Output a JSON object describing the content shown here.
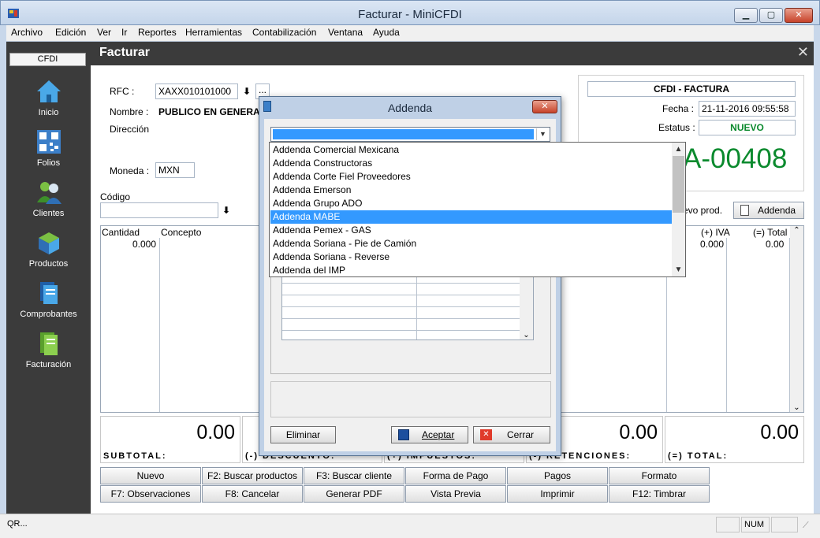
{
  "window": {
    "title": "Facturar - MiniCFDI",
    "minimize": "▁",
    "maximize": "▢",
    "close": "✕"
  },
  "menu": [
    "Archivo",
    "Edición",
    "Ver",
    "Ir",
    "Reportes",
    "Herramientas",
    "Contabilización",
    "Ventana",
    "Ayuda"
  ],
  "sidebar": {
    "tab": "CFDI",
    "items": [
      {
        "label": "Inicio",
        "icon": "house-icon"
      },
      {
        "label": "Folios",
        "icon": "qr-code-icon"
      },
      {
        "label": "Clientes",
        "icon": "users-icon"
      },
      {
        "label": "Productos",
        "icon": "box-icon"
      },
      {
        "label": "Comprobantes",
        "icon": "documents-icon"
      },
      {
        "label": "Facturación",
        "icon": "invoice-icon"
      }
    ]
  },
  "page": {
    "title": "Facturar",
    "close": "✕"
  },
  "form": {
    "rfc_label": "RFC :",
    "rfc_value": "XAXX010101000",
    "nombre_label": "Nombre :",
    "nombre_value": "PUBLICO EN GENERAL",
    "direccion_label": "Dirección",
    "moneda_label": "Moneda :",
    "moneda_value": "MXN",
    "codigo_label": "Código",
    "nuevo_prod": "evo prod.",
    "addenda_button": "Addenda",
    "browse": "..."
  },
  "cfdi": {
    "header": "CFDI - FACTURA",
    "fecha_label": "Fecha :",
    "fecha_value": "21-11-2016 09:55:58",
    "estatus_label": "Estatus :",
    "estatus_value": "NUEVO",
    "folio": "A-00408"
  },
  "grid": {
    "headers": {
      "cantidad": "Cantidad",
      "concepto": "Concepto",
      "iva": "(+) IVA",
      "total": "(=) Total"
    },
    "row": {
      "cantidad": "0.000",
      "iva": "0.000",
      "total": "0.00"
    }
  },
  "totals": {
    "subtotal": {
      "value": "0.00",
      "label": "SUBTOTAL:"
    },
    "descuento": {
      "label": "(-) DESCUENTO:"
    },
    "impuestos": {
      "label": "(+) IMPUESTOS:"
    },
    "retenciones": {
      "value": "0.00",
      "label": "(-) RETENCIONES:"
    },
    "total": {
      "value": "0.00",
      "label": "(=) TOTAL:"
    }
  },
  "function_buttons": {
    "row1": [
      "Nuevo",
      "F2: Buscar productos",
      "F3: Buscar cliente",
      "Forma de Pago",
      "Pagos",
      "Formato"
    ],
    "row2": [
      "F7: Observaciones",
      "F8: Cancelar",
      "Generar PDF",
      "Vista Previa",
      "Imprimir",
      "F12:  Timbrar"
    ]
  },
  "status": {
    "left": "QR...",
    "num": "NUM"
  },
  "dialog": {
    "title": "Addenda",
    "eliminar": "Eliminar",
    "aceptar": "Aceptar",
    "cerrar": "Cerrar",
    "options": [
      "Addenda Comercial Mexicana",
      "Addenda Constructoras",
      "Addenda Corte Fiel Proveedores",
      "Addenda Emerson",
      "Addenda Grupo ADO",
      "Addenda MABE",
      "Addenda Pemex - GAS",
      "Addenda Soriana - Pie de Camión",
      "Addenda Soriana - Reverse",
      "Addenda del IMP"
    ],
    "selected_index": 5
  },
  "colors": {
    "accent": "#3399ff",
    "folio": "#0b8a2e",
    "sidebar": "#3b3b3b"
  }
}
